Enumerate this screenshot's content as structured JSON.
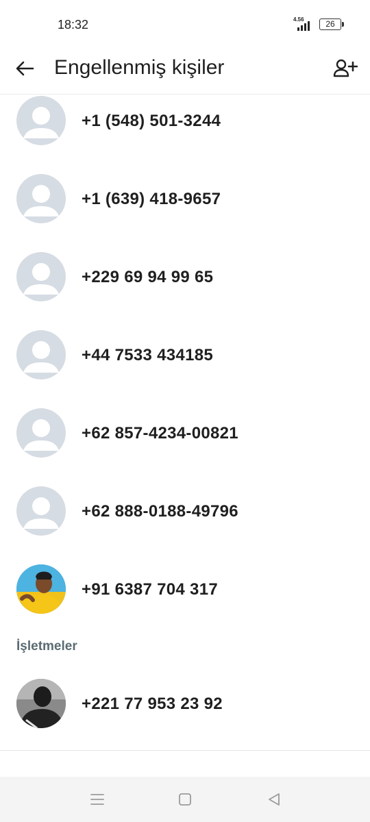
{
  "status_bar": {
    "time": "18:32",
    "network_type": "4.56",
    "battery_level": "26"
  },
  "app_bar": {
    "title": "Engellenmiş kişiler",
    "back_icon": "arrow-left-icon",
    "add_icon": "add-person-icon"
  },
  "blocked_contacts": [
    {
      "name": "+1 (548) 501-3244",
      "avatar": "default"
    },
    {
      "name": "+1 (639) 418-9657",
      "avatar": "default"
    },
    {
      "name": "+229 69 94 99 65",
      "avatar": "default"
    },
    {
      "name": "+44 7533 434185",
      "avatar": "default"
    },
    {
      "name": "+62 857-4234-00821",
      "avatar": "default"
    },
    {
      "name": "+62 888-0188-49796",
      "avatar": "default"
    },
    {
      "name": "+91 6387 704 317",
      "avatar": "photo-yellow"
    }
  ],
  "businesses_section": {
    "header": "İşletmeler",
    "items": [
      {
        "name": "+221 77 953 23 92",
        "avatar": "photo-dark"
      }
    ]
  },
  "nav_bar": {
    "menu_icon": "menu-icon",
    "home_icon": "home-square-icon",
    "back_icon": "back-triangle-icon"
  },
  "colors": {
    "avatar_bg": "#d6dce3",
    "avatar_fg": "#ffffff",
    "section_header": "#5b6b73",
    "text_primary": "#1f1f1f",
    "nav_bg": "#f4f4f5"
  }
}
